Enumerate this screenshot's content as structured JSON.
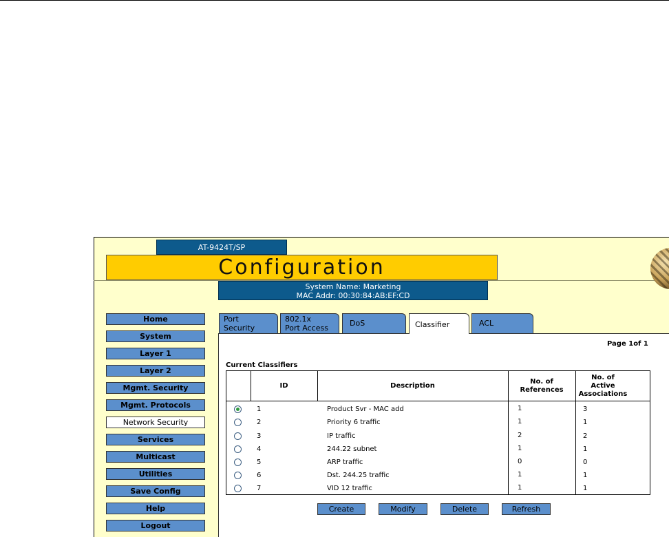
{
  "device": {
    "model": "AT-9424T/SP"
  },
  "banner": {
    "title": "Configuration"
  },
  "system_info": {
    "name_line": "System Name: Marketing",
    "mac_line": "MAC Addr: 00:30:84:AB:EF:CD"
  },
  "sidebar": {
    "active_item": "Network Security",
    "items": [
      {
        "label": "Home"
      },
      {
        "label": "System"
      },
      {
        "label": "Layer 1"
      },
      {
        "label": "Layer 2"
      },
      {
        "label": "Mgmt. Security"
      },
      {
        "label": "Mgmt. Protocols"
      },
      {
        "label": "Network Security"
      },
      {
        "label": "Services"
      },
      {
        "label": "Multicast"
      },
      {
        "label": "Utilities"
      },
      {
        "label": "Save Config"
      },
      {
        "label": "Help"
      },
      {
        "label": "Logout"
      }
    ]
  },
  "tabs": [
    {
      "line1": "Port",
      "line2": "Security"
    },
    {
      "line1": "802.1x",
      "line2": "Port Access"
    },
    {
      "label": "DoS"
    },
    {
      "label": "Classifier",
      "active": true
    },
    {
      "label": "ACL"
    }
  ],
  "pagination": {
    "text": "Page 1of 1"
  },
  "classifiers": {
    "title": "Current Classifiers",
    "headers": {
      "id": "ID",
      "description": "Description",
      "references": [
        "No. of",
        "References"
      ],
      "associations": [
        "No. of",
        "Active",
        "Associations"
      ]
    },
    "selected_row": 0,
    "rows": [
      {
        "id": "1",
        "description": "Product Svr - MAC add",
        "references": "1",
        "associations": "3"
      },
      {
        "id": "2",
        "description": "Priority 6 traffic",
        "references": "1",
        "associations": "1"
      },
      {
        "id": "3",
        "description": "IP traffic",
        "references": "2",
        "associations": "2"
      },
      {
        "id": "4",
        "description": "244.22 subnet",
        "references": "1",
        "associations": "1"
      },
      {
        "id": "5",
        "description": "ARP traffic",
        "references": "0",
        "associations": "0"
      },
      {
        "id": "6",
        "description": "Dst. 244.25 traffic",
        "references": "1",
        "associations": "1"
      },
      {
        "id": "7",
        "description": "VID 12 traffic",
        "references": "1",
        "associations": "1"
      }
    ]
  },
  "actions": {
    "create": "Create",
    "modify": "Modify",
    "delete": "Delete",
    "refresh": "Refresh"
  },
  "colors": {
    "background": "#ffffcc",
    "banner": "#ffcc00",
    "header_blue": "#0d5a8c",
    "button_blue": "#5b8fcc"
  }
}
